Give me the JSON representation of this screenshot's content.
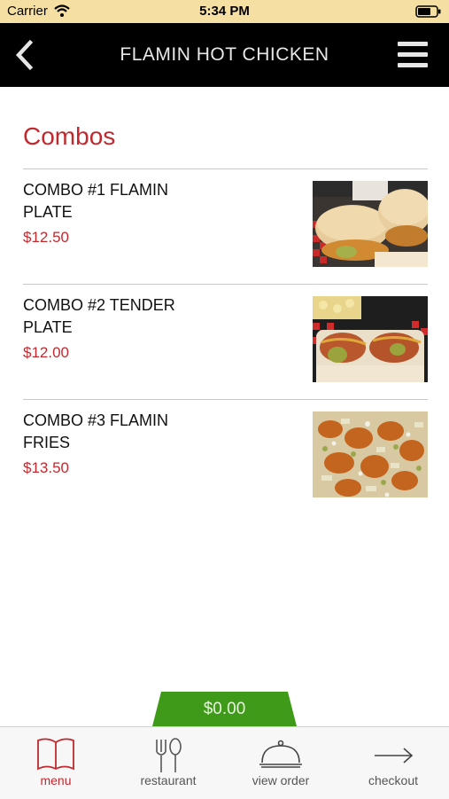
{
  "status_bar": {
    "carrier": "Carrier",
    "time": "5:34 PM"
  },
  "nav": {
    "title": "FLAMIN HOT CHICKEN"
  },
  "section": {
    "title": "Combos"
  },
  "items": [
    {
      "name": "COMBO #1 FLAMIN PLATE",
      "price": "$12.50"
    },
    {
      "name": "COMBO #2 TENDER PLATE",
      "price": "$12.00"
    },
    {
      "name": "COMBO #3 FLAMIN FRIES",
      "price": "$13.50"
    }
  ],
  "order_total": "$0.00",
  "tabs": [
    {
      "label": "menu",
      "icon": "book-icon",
      "active": true
    },
    {
      "label": "restaurant",
      "icon": "fork-spoon-icon",
      "active": false
    },
    {
      "label": "view order",
      "icon": "cloche-icon",
      "active": false
    },
    {
      "label": "checkout",
      "icon": "arrow-right-icon",
      "active": false
    }
  ],
  "colors": {
    "accent": "#c1292e",
    "nav_bg": "#000000",
    "status_bg": "#f6dfa3",
    "total_bg": "#3f9a1a"
  }
}
